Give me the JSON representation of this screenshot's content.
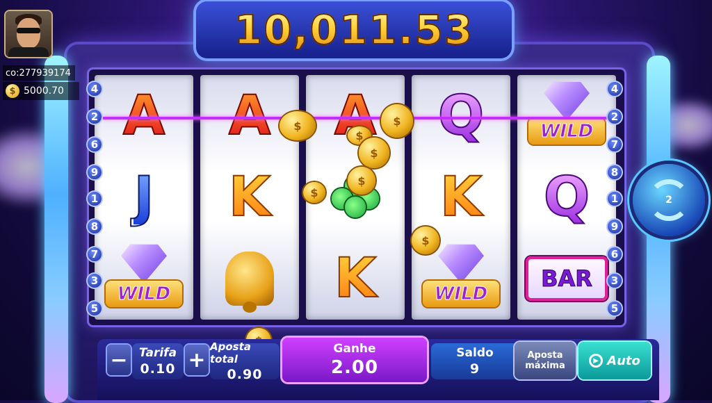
{
  "jackpot": {
    "amount": "10,011.53"
  },
  "player": {
    "id": "co:277939174",
    "balance": "5000.70",
    "currency_symbol": "$"
  },
  "paylines": {
    "left": [
      "4",
      "2",
      "6",
      "9",
      "1",
      "8",
      "7",
      "3",
      "5"
    ],
    "right": [
      "4",
      "2",
      "7",
      "8",
      "1",
      "9",
      "6",
      "3",
      "5"
    ]
  },
  "reels": [
    [
      {
        "type": "letter",
        "text": "A",
        "style": "A"
      },
      {
        "type": "letter",
        "text": "J",
        "style": "J"
      },
      {
        "type": "wild",
        "text": "WILD"
      }
    ],
    [
      {
        "type": "letter",
        "text": "A",
        "style": "A"
      },
      {
        "type": "letter",
        "text": "K",
        "style": "K"
      },
      {
        "type": "bell",
        "text": ""
      }
    ],
    [
      {
        "type": "letter",
        "text": "A",
        "style": "A"
      },
      {
        "type": "clover",
        "text": ""
      },
      {
        "type": "letter",
        "text": "K",
        "style": "K"
      }
    ],
    [
      {
        "type": "letter",
        "text": "Q",
        "style": "Q"
      },
      {
        "type": "letter",
        "text": "K",
        "style": "K"
      },
      {
        "type": "wild",
        "text": "WILD"
      }
    ],
    [
      {
        "type": "wild",
        "text": "WILD"
      },
      {
        "type": "letter",
        "text": "Q",
        "style": "Q"
      },
      {
        "type": "bar",
        "text": "BAR"
      }
    ]
  ],
  "spin_button": {
    "count": "2"
  },
  "controls": {
    "minus": "−",
    "plus": "+",
    "tarifa_label": "Tarifa",
    "tarifa_value": "0.10",
    "aposta_total_label": "Aposta total",
    "aposta_total_value": "0.90",
    "ganhe_label": "Ganhe",
    "ganhe_value": "2.00",
    "saldo_label": "Saldo",
    "saldo_value": "9",
    "aposta_maxima_label": "Aposta máxima",
    "auto_label": "Auto"
  },
  "colors": {
    "payline": "#c030ff",
    "jackpot_gold": "#ffd23a",
    "panel": "#2a2a9a",
    "auto_button": "#1ab8a8"
  }
}
